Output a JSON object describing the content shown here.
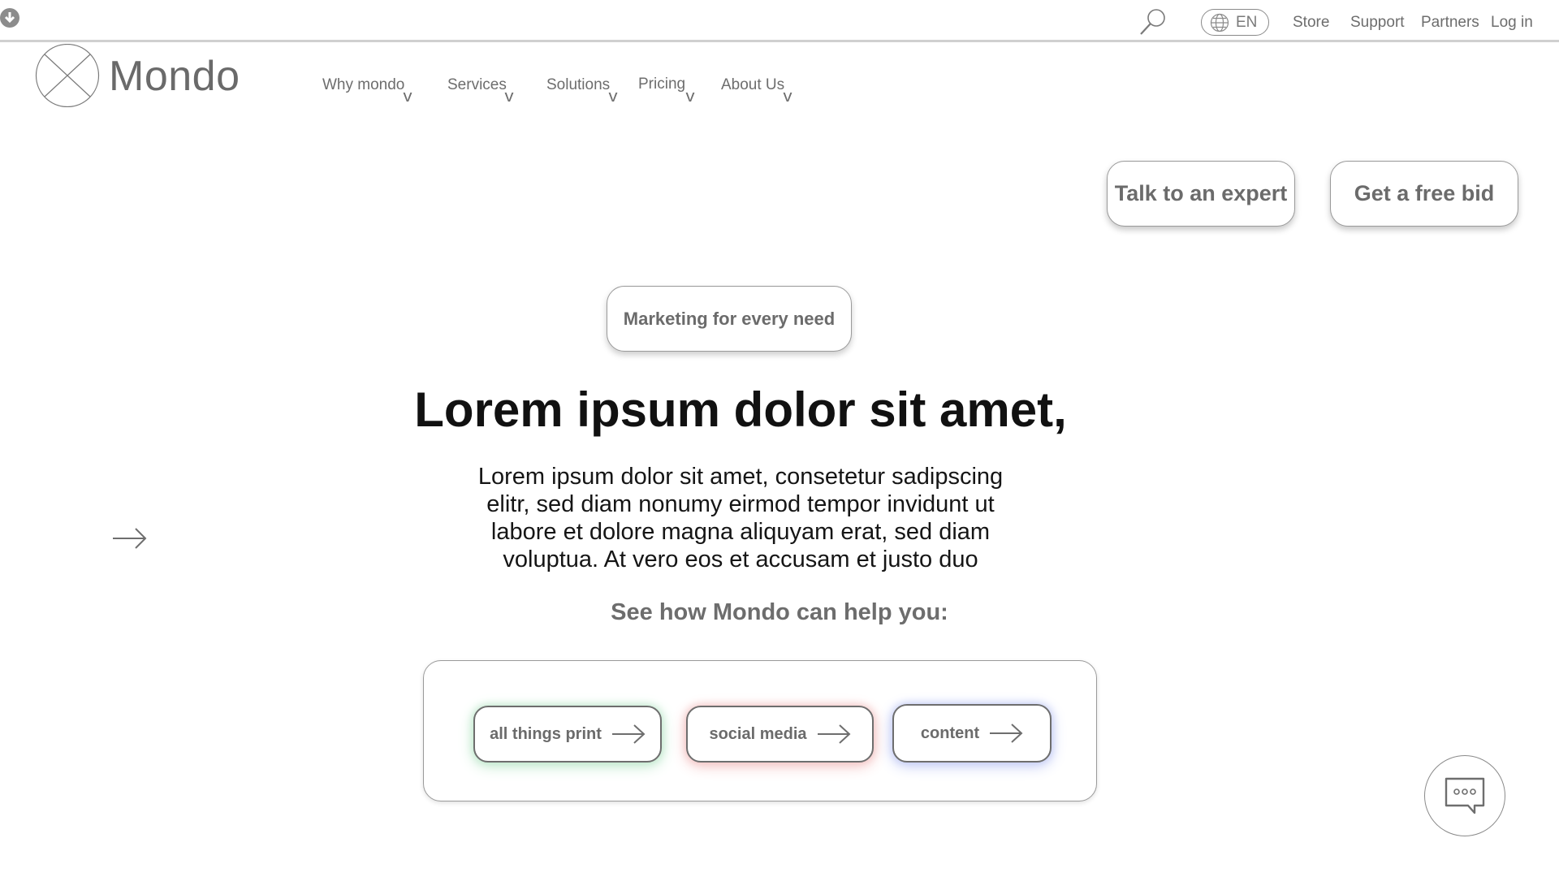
{
  "topbar": {
    "language_label": "EN",
    "links": {
      "store": "Store",
      "support": "Support",
      "partners": "Partners",
      "login": "Log in"
    }
  },
  "brand": {
    "name": "Mondo"
  },
  "nav": {
    "why": "Why mondo",
    "services": "Services",
    "solutions": "Solutions",
    "pricing": "Pricing",
    "about": "About Us",
    "caret": "v"
  },
  "cta": {
    "expert": "Talk to an expert",
    "bid": "Get a free bid"
  },
  "hero": {
    "tag": "Marketing for every need",
    "title": "Lorem ipsum dolor sit amet,",
    "body": "Lorem ipsum dolor sit amet, consetetur sadipscing elitr, sed diam nonumy eirmod tempor invidunt ut labore et dolore magna aliquyam erat, sed diam voluptua. At vero eos et accusam et justo duo",
    "subheading": "See how Mondo can help you:"
  },
  "chooser": {
    "print": {
      "label": "all things print",
      "glow": "#bfe8cc"
    },
    "social": {
      "label": "social media",
      "glow": "#f3c4c4"
    },
    "content": {
      "label": "content",
      "glow": "#c4ccf5"
    }
  },
  "icons": {
    "download": "download-circle-icon",
    "search": "search-icon",
    "globe": "globe-icon",
    "arrow": "arrow-right-icon",
    "chat": "chat-bubble-icon"
  }
}
